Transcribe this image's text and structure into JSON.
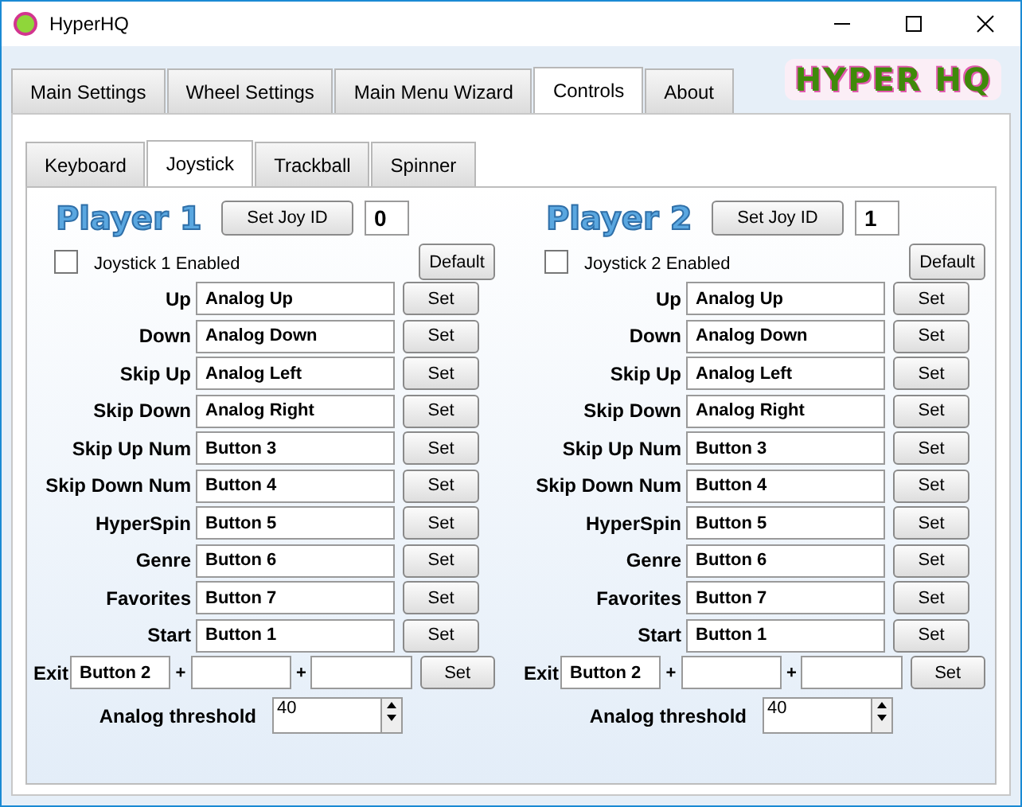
{
  "window": {
    "title": "HyperHQ"
  },
  "logo": {
    "text": "HYPER HQ"
  },
  "tabs": [
    {
      "label": "Main Settings",
      "selected": false
    },
    {
      "label": "Wheel Settings",
      "selected": false
    },
    {
      "label": "Main Menu Wizard",
      "selected": false
    },
    {
      "label": "Controls",
      "selected": true
    },
    {
      "label": "About",
      "selected": false
    }
  ],
  "subtabs": [
    {
      "label": "Keyboard",
      "selected": false
    },
    {
      "label": "Joystick",
      "selected": true
    },
    {
      "label": "Trackball",
      "selected": false
    },
    {
      "label": "Spinner",
      "selected": false
    }
  ],
  "players": [
    {
      "title": "Player 1",
      "set_id_button": "Set Joy ID",
      "joy_id": "0",
      "enabled_label": "Joystick 1 Enabled",
      "enabled": false,
      "default_button": "Default",
      "mappings": [
        {
          "label": "Up",
          "value": "Analog Up",
          "button": "Set"
        },
        {
          "label": "Down",
          "value": "Analog Down",
          "button": "Set"
        },
        {
          "label": "Skip Up",
          "value": "Analog Left",
          "button": "Set"
        },
        {
          "label": "Skip Down",
          "value": "Analog Right",
          "button": "Set"
        },
        {
          "label": "Skip Up Num",
          "value": "Button 3",
          "button": "Set"
        },
        {
          "label": "Skip Down Num",
          "value": "Button 4",
          "button": "Set"
        },
        {
          "label": "HyperSpin",
          "value": "Button 5",
          "button": "Set"
        },
        {
          "label": "Genre",
          "value": "Button 6",
          "button": "Set"
        },
        {
          "label": "Favorites",
          "value": "Button 7",
          "button": "Set"
        },
        {
          "label": "Start",
          "value": "Button 1",
          "button": "Set"
        }
      ],
      "exit": {
        "label": "Exit",
        "value": "Button 2",
        "plus": [
          "+",
          "+"
        ],
        "button": "Set"
      },
      "threshold": {
        "label": "Analog threshold",
        "value": "40"
      }
    },
    {
      "title": "Player 2",
      "set_id_button": "Set Joy ID",
      "joy_id": "1",
      "enabled_label": "Joystick 2 Enabled",
      "enabled": false,
      "default_button": "Default",
      "mappings": [
        {
          "label": "Up",
          "value": "Analog Up",
          "button": "Set"
        },
        {
          "label": "Down",
          "value": "Analog Down",
          "button": "Set"
        },
        {
          "label": "Skip Up",
          "value": "Analog Left",
          "button": "Set"
        },
        {
          "label": "Skip Down",
          "value": "Analog Right",
          "button": "Set"
        },
        {
          "label": "Skip Up Num",
          "value": "Button 3",
          "button": "Set"
        },
        {
          "label": "Skip Down Num",
          "value": "Button 4",
          "button": "Set"
        },
        {
          "label": "HyperSpin",
          "value": "Button 5",
          "button": "Set"
        },
        {
          "label": "Genre",
          "value": "Button 6",
          "button": "Set"
        },
        {
          "label": "Favorites",
          "value": "Button 7",
          "button": "Set"
        },
        {
          "label": "Start",
          "value": "Button 1",
          "button": "Set"
        }
      ],
      "exit": {
        "label": "Exit",
        "value": "Button 2",
        "plus": [
          "+",
          "+"
        ],
        "button": "Set"
      },
      "threshold": {
        "label": "Analog threshold",
        "value": "40"
      }
    }
  ]
}
